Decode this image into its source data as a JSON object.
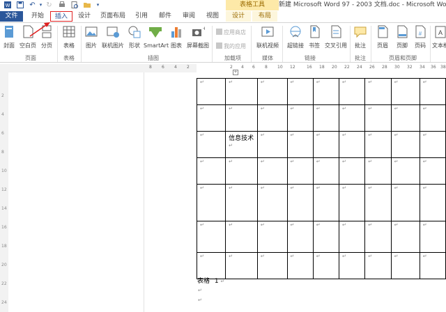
{
  "titlebar": {
    "table_tools": "表格工具",
    "document_title": "新建 Microsoft Word 97 - 2003 文档.doc - Microsoft Word"
  },
  "tabs": [
    "文件",
    "开始",
    "插入",
    "设计",
    "页面布局",
    "引用",
    "邮件",
    "审阅",
    "视图",
    "设计",
    "布局"
  ],
  "ribbon": {
    "buttons": [
      "封面",
      "空白页",
      "分页",
      "表格",
      "图片",
      "联机图片",
      "形状",
      "SmartArt",
      "图表",
      "屏幕截图",
      "联机视频",
      "超链接",
      "书签",
      "交叉引用",
      "批注",
      "页眉",
      "页脚",
      "页码",
      "文本框"
    ],
    "small_commands": [
      "应用商店",
      "我的应用"
    ],
    "groups": [
      "页面",
      "表格",
      "插图",
      "加载项",
      "媒体",
      "链接",
      "批注",
      "页眉和页脚"
    ]
  },
  "ruler": {
    "top_numbers": [
      "8",
      "6",
      "4",
      "2",
      "2",
      "4",
      "6",
      "8",
      "10",
      "12",
      "16",
      "18",
      "20",
      "22",
      "24",
      "26",
      "28",
      "30",
      "32",
      "34",
      "36",
      "38",
      "40"
    ],
    "left_numbers": [
      "2",
      "4",
      "6",
      "8",
      "10",
      "12",
      "14",
      "16",
      "18",
      "20",
      "22",
      "24"
    ]
  },
  "document": {
    "para_mark": "↵",
    "cell_text": "信息技术",
    "caption": "表格",
    "caption_number": "1",
    "table_handle": "+"
  },
  "colors": {
    "file_tab": "#2b579a",
    "contextual_tab": "#fde9a8",
    "annotation": "#e02020"
  }
}
